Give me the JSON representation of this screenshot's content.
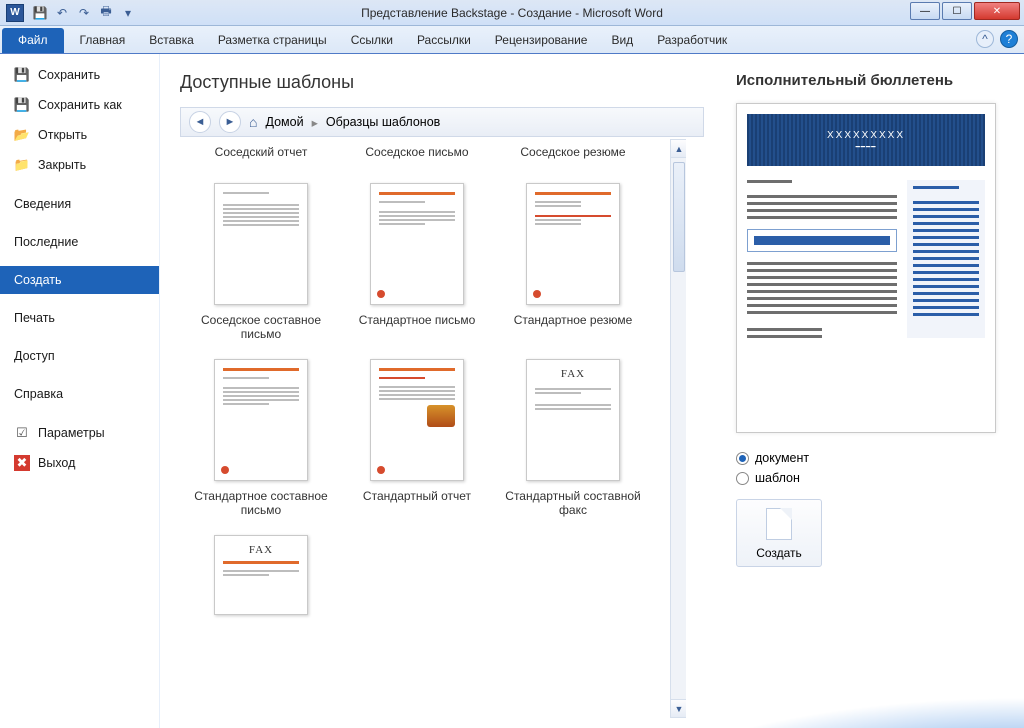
{
  "titlebar": {
    "title": "Представление Backstage - Создание  -  Microsoft Word"
  },
  "ribbon": {
    "file": "Файл",
    "tabs": [
      "Главная",
      "Вставка",
      "Разметка страницы",
      "Ссылки",
      "Рассылки",
      "Рецензирование",
      "Вид",
      "Разработчик"
    ]
  },
  "sidebar": {
    "items": [
      {
        "label": "Сохранить",
        "icon": "save"
      },
      {
        "label": "Сохранить как",
        "icon": "save"
      },
      {
        "label": "Открыть",
        "icon": "open"
      },
      {
        "label": "Закрыть",
        "icon": "close"
      },
      {
        "label": "Сведения"
      },
      {
        "label": "Последние"
      },
      {
        "label": "Создать",
        "active": true
      },
      {
        "label": "Печать"
      },
      {
        "label": "Доступ"
      },
      {
        "label": "Справка"
      },
      {
        "label": "Параметры",
        "icon": "param"
      },
      {
        "label": "Выход",
        "icon": "exit"
      }
    ]
  },
  "center": {
    "title": "Доступные шаблоны",
    "breadcrumb": {
      "home": "Домой",
      "current": "Образцы шаблонов"
    },
    "templates_row0": [
      "Соседский отчет",
      "Соседское письмо",
      "Соседское резюме"
    ],
    "templates": [
      "Соседское составное письмо",
      "Стандартное письмо",
      "Стандартное резюме",
      "Стандартное составное письмо",
      "Стандартный отчет",
      "Стандартный составной факс"
    ],
    "template_fax_prefix": "FAX"
  },
  "right": {
    "title": "Исполнительный бюллетень",
    "preview_heading": "XXXXXXXXX",
    "radio_doc": "документ",
    "radio_tpl": "шаблон",
    "create": "Создать"
  }
}
